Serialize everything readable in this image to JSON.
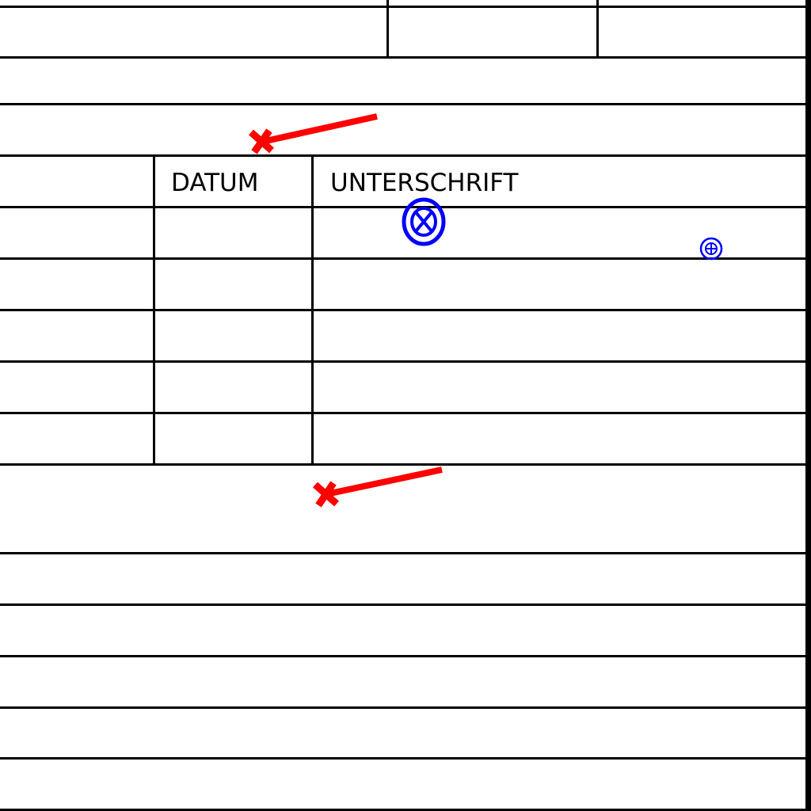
{
  "form": {
    "columns": {
      "datum": "DATUM",
      "unterschrift": "UNTERSCHRIFT"
    },
    "entry_rows": [
      {
        "name": "",
        "datum": "",
        "unterschrift": ""
      },
      {
        "name": "",
        "datum": "",
        "unterschrift": ""
      },
      {
        "name": "",
        "datum": "",
        "unterschrift": ""
      },
      {
        "name": "",
        "datum": "",
        "unterschrift": ""
      },
      {
        "name": "",
        "datum": "",
        "unterschrift": ""
      }
    ]
  },
  "annotations": {
    "pointer_color": "#ff0000",
    "target_color": "#0000ff",
    "pointers": [
      "pointer-arrow-icon",
      "pointer-arrow-icon"
    ],
    "targets": [
      "circled-x-icon",
      "circled-plus-icon"
    ]
  }
}
